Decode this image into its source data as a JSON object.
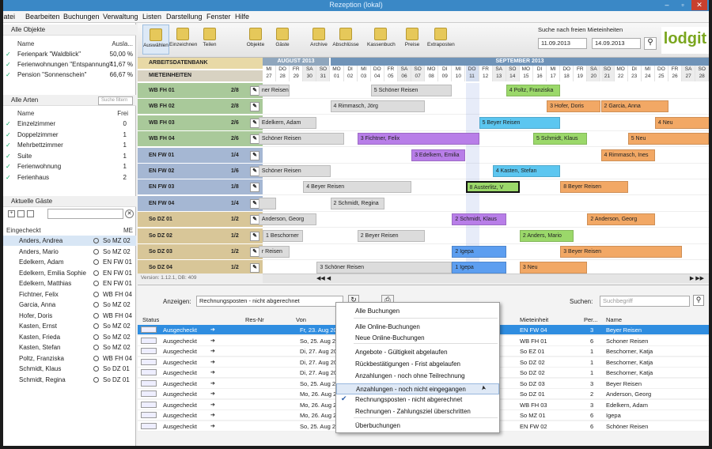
{
  "window": {
    "title": "Rezeption (lokal)"
  },
  "menu": [
    "Datei",
    "Bearbeiten",
    "Buchungen",
    "Verwaltung",
    "Listen",
    "Darstellung",
    "Fenster",
    "Hilfe"
  ],
  "objects": {
    "title": "Alle Objekte",
    "col_name": "Name",
    "col_util": "Ausla...",
    "items": [
      {
        "name": "Ferienpark \"Waldblick\"",
        "util": "50,00 %"
      },
      {
        "name": "Ferienwohnungen \"Entspannung\"",
        "util": "41,67 %"
      },
      {
        "name": "Pension \"Sonnenschein\"",
        "util": "66,67 %"
      }
    ]
  },
  "types": {
    "title": "Alle Arten",
    "search_placeholder": "Suche filtern",
    "col_name": "Name",
    "col_free": "Frei",
    "items": [
      {
        "name": "Einzelzimmer",
        "free": "0"
      },
      {
        "name": "Doppelzimmer",
        "free": "1"
      },
      {
        "name": "Mehrbettzimmer",
        "free": "1"
      },
      {
        "name": "Suite",
        "free": "1"
      },
      {
        "name": "Ferienwohnung",
        "free": "1"
      },
      {
        "name": "Ferienhaus",
        "free": "2"
      }
    ]
  },
  "guests": {
    "title": "Aktuelle Gäste",
    "col_name": "Eingecheckt",
    "col_unit": "ME",
    "items": [
      {
        "name": "Anders, Andrea",
        "unit": "So MZ 02"
      },
      {
        "name": "Anders, Mario",
        "unit": "So MZ 02"
      },
      {
        "name": "Edelkern, Adam",
        "unit": "EN FW 01"
      },
      {
        "name": "Edelkern, Emilia Sophie",
        "unit": "EN FW 01"
      },
      {
        "name": "Edelkern, Matthias",
        "unit": "EN FW 01"
      },
      {
        "name": "Fichtner, Felix",
        "unit": "WB FH 04"
      },
      {
        "name": "Garcia, Anna",
        "unit": "So MZ 02"
      },
      {
        "name": "Hofer, Doris",
        "unit": "WB FH 04"
      },
      {
        "name": "Kasten, Ernst",
        "unit": "So MZ 02"
      },
      {
        "name": "Kasten, Frieda",
        "unit": "So MZ 02"
      },
      {
        "name": "Kasten, Stefan",
        "unit": "So MZ 02"
      },
      {
        "name": "Poltz, Franziska",
        "unit": "WB FH 04"
      },
      {
        "name": "Schmidt, Klaus",
        "unit": "So DZ 01"
      },
      {
        "name": "Schmidt, Regina",
        "unit": "So DZ 01"
      }
    ]
  },
  "toolbar": [
    {
      "label": "Auswählen"
    },
    {
      "label": "Einzeichnen"
    },
    {
      "label": "Teilen"
    },
    {
      "label": "Objekte"
    },
    {
      "label": "Gäste"
    },
    {
      "label": "Archive"
    },
    {
      "label": "Abschlüsse"
    },
    {
      "label": "Kassenbuch"
    },
    {
      "label": "Preise"
    },
    {
      "label": "Extraposten"
    }
  ],
  "search": {
    "title": "Suche nach freien Mieteinheiten",
    "from": "11.09.2013",
    "to": "14.09.2013"
  },
  "logo": "lodgit",
  "grid": {
    "head1": "ARBEITSDATENBANK",
    "head2": "MIETEINHEITEN",
    "month1": "AUGUST 2013",
    "month2": "SEPTEMBER 2013",
    "days": [
      {
        "d": "MI",
        "n": "27"
      },
      {
        "d": "DO",
        "n": "28"
      },
      {
        "d": "FR",
        "n": "29"
      },
      {
        "d": "SA",
        "n": "30"
      },
      {
        "d": "SO",
        "n": "31"
      },
      {
        "d": "MO",
        "n": "01"
      },
      {
        "d": "DI",
        "n": "02"
      },
      {
        "d": "MI",
        "n": "03"
      },
      {
        "d": "DO",
        "n": "04"
      },
      {
        "d": "FR",
        "n": "05"
      },
      {
        "d": "SA",
        "n": "06"
      },
      {
        "d": "SO",
        "n": "07"
      },
      {
        "d": "MO",
        "n": "08"
      },
      {
        "d": "DI",
        "n": "09"
      },
      {
        "d": "MI",
        "n": "10"
      },
      {
        "d": "DO",
        "n": "11"
      },
      {
        "d": "FR",
        "n": "12"
      },
      {
        "d": "SA",
        "n": "13"
      },
      {
        "d": "SO",
        "n": "14"
      },
      {
        "d": "MO",
        "n": "15"
      },
      {
        "d": "DI",
        "n": "16"
      },
      {
        "d": "MI",
        "n": "17"
      },
      {
        "d": "DO",
        "n": "18"
      },
      {
        "d": "FR",
        "n": "19"
      },
      {
        "d": "SA",
        "n": "20"
      },
      {
        "d": "SO",
        "n": "21"
      },
      {
        "d": "MO",
        "n": "22"
      },
      {
        "d": "DI",
        "n": "23"
      },
      {
        "d": "MI",
        "n": "24"
      },
      {
        "d": "DO",
        "n": "25"
      },
      {
        "d": "FR",
        "n": "26"
      },
      {
        "d": "SA",
        "n": "27"
      },
      {
        "d": "SO",
        "n": "28"
      }
    ],
    "units": [
      {
        "name": "WB FH 01",
        "beds": "2/8"
      },
      {
        "name": "WB FH 02",
        "beds": "2/8"
      },
      {
        "name": "WB FH 03",
        "beds": "2/6"
      },
      {
        "name": "WB FH 04",
        "beds": "2/6"
      },
      {
        "name": "EN FW 01",
        "beds": "1/4"
      },
      {
        "name": "EN FW 02",
        "beds": "1/6"
      },
      {
        "name": "EN FW 03",
        "beds": "1/8"
      },
      {
        "name": "EN FW 04",
        "beds": "1/4"
      },
      {
        "name": "So DZ 01",
        "beds": "1/2"
      },
      {
        "name": "So DZ 02",
        "beds": "1/2"
      },
      {
        "name": "So DZ 03",
        "beds": "1/2"
      },
      {
        "name": "So DZ 04",
        "beds": "1/2"
      }
    ],
    "version": "Version: 1.12.1, DB: 409"
  },
  "bookings": [
    {
      "row": 0,
      "s": -1,
      "e": 2,
      "label": "ner Reisen",
      "c": "#dcdcdc"
    },
    {
      "row": 0,
      "s": 8,
      "e": 14,
      "label": "5 Schöner Reisen",
      "c": "#dcdcdc"
    },
    {
      "row": 0,
      "s": 18,
      "e": 22,
      "label": "4 Poltz, Franziska",
      "c": "#9bd86a"
    },
    {
      "row": 1,
      "s": 5,
      "e": 12,
      "label": "4 Rimmasch, Jörg",
      "c": "#dcdcdc"
    },
    {
      "row": 1,
      "s": 21,
      "e": 25,
      "label": "3 Hofer, Doris",
      "c": "#f2a865"
    },
    {
      "row": 1,
      "s": 25,
      "e": 30,
      "label": "2 Garcia, Anna",
      "c": "#f2a865"
    },
    {
      "row": 2,
      "s": -1,
      "e": 4,
      "label": "Edelkern, Adam",
      "c": "#dcdcdc"
    },
    {
      "row": 2,
      "s": 16,
      "e": 22,
      "label": "5 Beyer Reisen",
      "c": "#5cc6f0"
    },
    {
      "row": 2,
      "s": 29,
      "e": 34,
      "label": "4 Neu",
      "c": "#f2a865"
    },
    {
      "row": 3,
      "s": -1,
      "e": 6,
      "label": "Schöner Reisen",
      "c": "#dcdcdc"
    },
    {
      "row": 3,
      "s": 7,
      "e": 16,
      "label": "3 Fichtner, Felix",
      "c": "#b87ee8"
    },
    {
      "row": 3,
      "s": 20,
      "e": 24,
      "label": "5 Schmidt, Klaus",
      "c": "#9bd86a"
    },
    {
      "row": 3,
      "s": 27,
      "e": 33,
      "label": "5 Neu",
      "c": "#f2a865"
    },
    {
      "row": 4,
      "s": 11,
      "e": 15,
      "label": "3 Edelkern, Emilia",
      "c": "#b87ee8"
    },
    {
      "row": 4,
      "s": 25,
      "e": 29,
      "label": "4 Rimmasch, Ines",
      "c": "#f2a865"
    },
    {
      "row": 5,
      "s": -1,
      "e": 5,
      "label": "Schöner Reisen",
      "c": "#dcdcdc"
    },
    {
      "row": 5,
      "s": 17,
      "e": 22,
      "label": "4 Kasten, Stefan",
      "c": "#5cc6f0"
    },
    {
      "row": 6,
      "s": 3,
      "e": 11,
      "label": "4 Beyer Reisen",
      "c": "#dcdcdc"
    },
    {
      "row": 6,
      "s": 15,
      "e": 19,
      "label": "8 Austerlitz, V",
      "c": "#9bd86a"
    },
    {
      "row": 6,
      "s": 22,
      "e": 27,
      "label": "8 Beyer Reisen",
      "c": "#f2a865"
    },
    {
      "row": 7,
      "s": -1,
      "e": 1,
      "label": "",
      "c": "#dcdcdc"
    },
    {
      "row": 7,
      "s": 5,
      "e": 9,
      "label": "2 Schmidt, Regina",
      "c": "#dcdcdc"
    },
    {
      "row": 8,
      "s": -1,
      "e": 4,
      "label": "Anderson, Georg",
      "c": "#dcdcdc"
    },
    {
      "row": 8,
      "s": 14,
      "e": 18,
      "label": "2 Schmidt, Klaus",
      "c": "#b87ee8"
    },
    {
      "row": 8,
      "s": 24,
      "e": 29,
      "label": "2 Anderson, Georg",
      "c": "#f2a865"
    },
    {
      "row": 9,
      "s": 0,
      "e": 3,
      "label": "1 Beschorner",
      "c": "#dcdcdc"
    },
    {
      "row": 9,
      "s": 7,
      "e": 12,
      "label": "2 Beyer Reisen",
      "c": "#dcdcdc"
    },
    {
      "row": 9,
      "s": 19,
      "e": 23,
      "label": "2 Anders, Mario",
      "c": "#9bd86a"
    },
    {
      "row": 10,
      "s": -1,
      "e": 2,
      "label": "r Reisen",
      "c": "#dcdcdc"
    },
    {
      "row": 10,
      "s": 14,
      "e": 18,
      "label": "2 Igepa",
      "c": "#5c9ef0"
    },
    {
      "row": 10,
      "s": 22,
      "e": 31,
      "label": "3 Beyer Reisen",
      "c": "#f2a865"
    },
    {
      "row": 11,
      "s": 4,
      "e": 14,
      "label": "3 Schöner Reisen",
      "c": "#dcdcdc"
    },
    {
      "row": 11,
      "s": 14,
      "e": 18,
      "label": "1 Igepa",
      "c": "#5c9ef0"
    },
    {
      "row": 11,
      "s": 19,
      "e": 24,
      "label": "3 Neu",
      "c": "#f2a865"
    }
  ],
  "lower": {
    "show_label": "Anzeigen:",
    "show_value": "Rechnungsposten - nicht abgerechnet",
    "search_label": "Suchen:",
    "search_placeholder": "Suchbegriff",
    "cols": {
      "status": "Status",
      "resnr": "Res-Nr",
      "von": "Von",
      "unit": "Mieteinheit",
      "persons": "Per...",
      "name": "Name"
    },
    "rows": [
      {
        "status": "Ausgecheckt",
        "von": "Fr, 23. Aug 20",
        "unit": "EN FW 04",
        "p": "3",
        "name": "Beyer Reisen"
      },
      {
        "status": "Ausgecheckt",
        "von": "So, 25. Aug 20",
        "unit": "WB FH 01",
        "p": "6",
        "name": "Schoner Reisen"
      },
      {
        "status": "Ausgecheckt",
        "von": "Di, 27. Aug 20",
        "unit": "So EZ 01",
        "p": "1",
        "name": "Beschorner, Katja"
      },
      {
        "status": "Ausgecheckt",
        "von": "Di, 27. Aug 20",
        "unit": "So DZ 02",
        "p": "1",
        "name": "Beschorner, Katja"
      },
      {
        "status": "Ausgecheckt",
        "von": "Di, 27. Aug 20",
        "unit": "So DZ 02",
        "p": "1",
        "name": "Beschorner, Katja"
      },
      {
        "status": "Ausgecheckt",
        "von": "So, 25. Aug 20",
        "unit": "So DZ 03",
        "p": "3",
        "name": "Beyer Reisen"
      },
      {
        "status": "Ausgecheckt",
        "von": "Mo, 26. Aug 20",
        "unit": "So DZ 01",
        "p": "2",
        "name": "Anderson, Georg"
      },
      {
        "status": "Ausgecheckt",
        "von": "Mo, 26. Aug 20",
        "unit": "WB FH 03",
        "p": "3",
        "name": "Edelkern, Adam"
      },
      {
        "status": "Ausgecheckt",
        "von": "Mo, 26. Aug 20",
        "unit": "So MZ 01",
        "p": "6",
        "name": "Igepa"
      },
      {
        "status": "Ausgecheckt",
        "von": "So, 25. Aug 20",
        "unit": "EN FW 02",
        "p": "6",
        "name": "Schöner Reisen"
      }
    ]
  },
  "dropdown": [
    "Alle Buchungen",
    "Alle Online-Buchungen",
    "Neue Online-Buchungen",
    "Angebote - Gültigkeit abgelaufen",
    "Rückbestätigungen - Frist abgelaufen",
    "Anzahlungen - noch ohne Teilrechnung",
    "Anzahlungen - noch nicht eingegangen",
    "Rechnungsposten - nicht abgerechnet",
    "Rechnungen - Zahlungsziel überschritten",
    "Überbuchungen"
  ]
}
